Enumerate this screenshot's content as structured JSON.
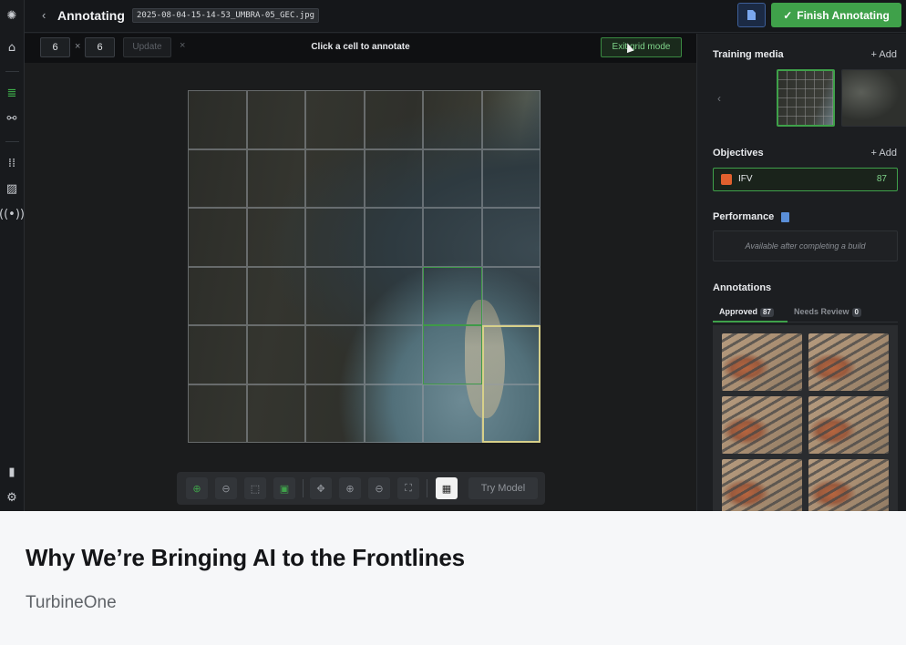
{
  "topbar": {
    "back_glyph": "‹",
    "title": "Annotating",
    "filename": "2025-08-04-15-14-53_UMBRA-05_GEC.jpg",
    "doc_icon": "document-icon",
    "finish_label": "Finish Annotating",
    "finish_icon": "check-icon"
  },
  "gridbar": {
    "rows": "6",
    "times": "×",
    "cols": "6",
    "update_label": "Update",
    "clear_glyph": "×",
    "hint": "Click a cell to annotate",
    "exit_label": "Exit grid mode"
  },
  "palette": {
    "tools": [
      "add-icon",
      "remove-icon",
      "box-icon",
      "image-icon",
      "move-icon",
      "zoom-in-icon",
      "zoom-out-icon",
      "fit-icon",
      "grid-icon"
    ],
    "try_label": "Try Model"
  },
  "panel": {
    "training_media": {
      "title": "Training media",
      "add_label": "+ Add"
    },
    "objectives": {
      "title": "Objectives",
      "add_label": "+ Add",
      "items": [
        {
          "name": "IFV",
          "count": "87",
          "color": "#e0602e"
        }
      ]
    },
    "performance": {
      "title": "Performance",
      "empty_text": "Available after completing a build"
    },
    "annotations": {
      "title": "Annotations",
      "tabs": [
        {
          "label": "Approved",
          "count": "87",
          "active": true
        },
        {
          "label": "Needs Review",
          "count": "0",
          "active": false
        }
      ]
    }
  },
  "colors": {
    "accent": "#3fa14a",
    "selected_cell": "#d7d08a",
    "objective": "#e0602e"
  },
  "card": {
    "title": "Why We’re Bringing AI to the Frontlines",
    "source": "TurbineOne"
  }
}
